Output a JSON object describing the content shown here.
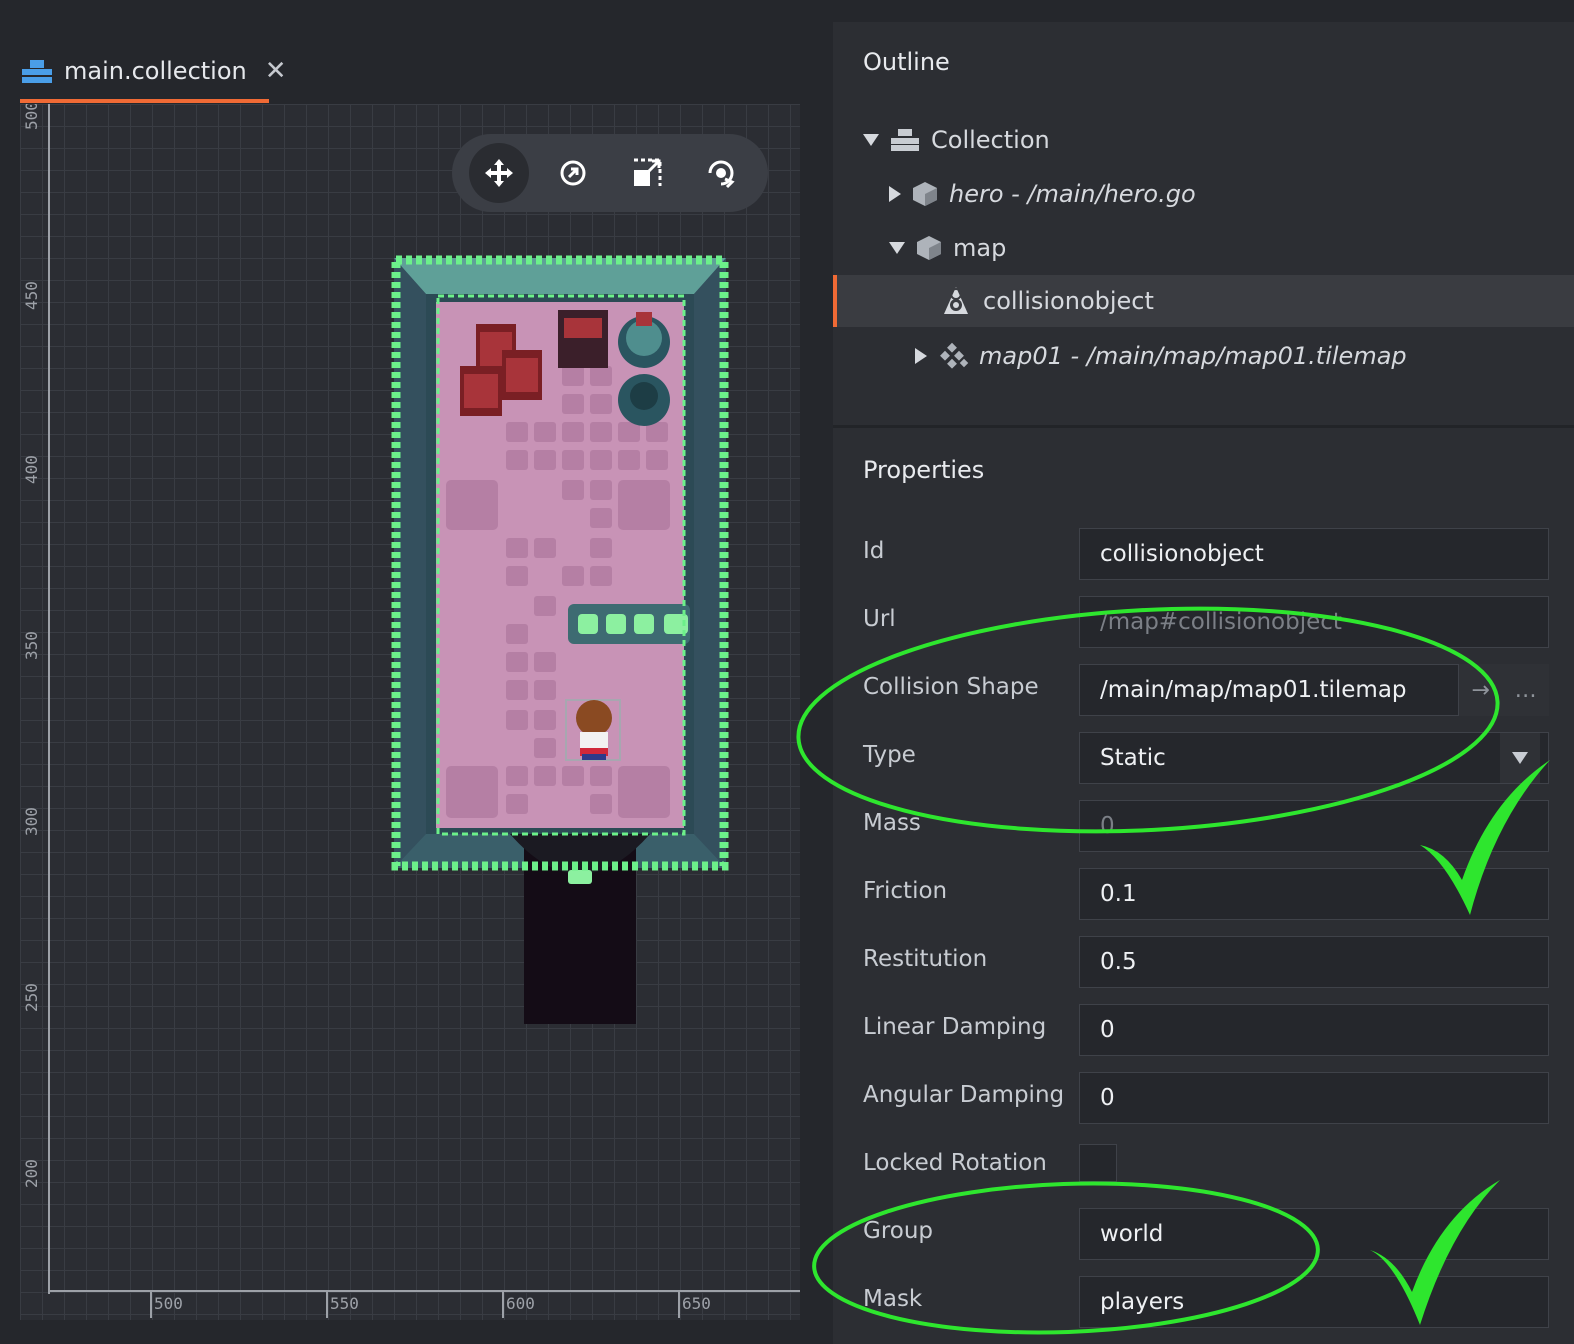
{
  "tab": {
    "title": "main.collection",
    "close": "✕",
    "icon": "collection-icon"
  },
  "rulers": {
    "vertical": [
      "500",
      "450",
      "400",
      "350",
      "300",
      "250",
      "200"
    ],
    "horizontal": [
      "500",
      "550",
      "600",
      "650"
    ]
  },
  "toolbar": {
    "tools": [
      "move-tool-icon",
      "rotate-tool-icon",
      "scale-tool-icon",
      "reset-view-icon"
    ],
    "active": "move-tool-icon"
  },
  "outline": {
    "title": "Outline",
    "items": [
      {
        "label": "Collection",
        "icon": "collection-icon",
        "expanded": true,
        "italic": false
      },
      {
        "label": "hero - /main/hero.go",
        "icon": "gameobject-icon",
        "expanded": false,
        "italic": true
      },
      {
        "label": "map",
        "icon": "gameobject-icon",
        "expanded": true,
        "italic": false
      },
      {
        "label": "collisionobject",
        "icon": "collision-object-icon",
        "selected": true,
        "italic": false
      },
      {
        "label": "map01 - /main/map/map01.tilemap",
        "icon": "tilemap-icon",
        "expanded": false,
        "italic": true
      }
    ]
  },
  "properties": {
    "title": "Properties",
    "id": {
      "label": "Id",
      "value": "collisionobject"
    },
    "url": {
      "label": "Url",
      "value": "/map#collisionobject"
    },
    "collision_shape": {
      "label": "Collision Shape",
      "value": "/main/map/map01.tilemap",
      "goto": "→",
      "browse": "…"
    },
    "type": {
      "label": "Type",
      "value": "Static"
    },
    "mass": {
      "label": "Mass",
      "value": "0"
    },
    "friction": {
      "label": "Friction",
      "value": "0.1"
    },
    "restitution": {
      "label": "Restitution",
      "value": "0.5"
    },
    "linear_damping": {
      "label": "Linear Damping",
      "value": "0"
    },
    "angular_damping": {
      "label": "Angular Damping",
      "value": "0"
    },
    "locked_rotation": {
      "label": "Locked Rotation",
      "checked": false
    },
    "group": {
      "label": "Group",
      "value": "world"
    },
    "mask": {
      "label": "Mask",
      "value": "players"
    }
  },
  "colors": {
    "accent": "#f06a35",
    "annotation": "#2ee62e",
    "selection_outline": "#6cf08a"
  }
}
